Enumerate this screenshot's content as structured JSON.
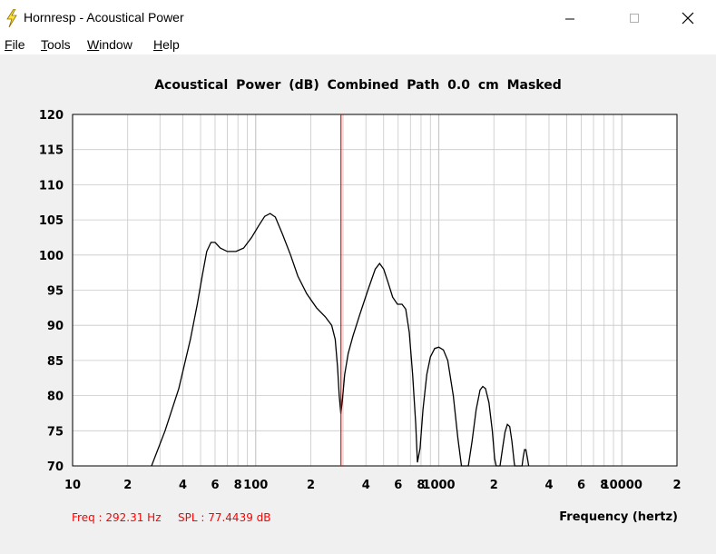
{
  "window": {
    "title": "Hornresp - Acoustical Power",
    "minimize_glyph": "—",
    "maximize_glyph": "☐",
    "close_glyph": "✕",
    "icon": "lightning-bolt-icon"
  },
  "menu": [
    "File",
    "Tools",
    "Window",
    "Help"
  ],
  "readout": {
    "freq": "Freq : 292.31 Hz",
    "spl": "SPL : 77.4439 dB"
  },
  "colors": {
    "cursor": "#ff0000",
    "curve": "#000000",
    "grid": "#c8c8c8",
    "readout": "#ff0000"
  },
  "chart_data": {
    "type": "line",
    "title": "Acoustical Power (dB)   Combined   Path 0.0 cm   Masked",
    "xlabel": "Frequency (hertz)",
    "ylabel": "",
    "x_scale": "log",
    "xlim": [
      10,
      20000
    ],
    "ylim": [
      70,
      120
    ],
    "y_ticks": [
      "120",
      "115",
      "110",
      "105",
      "100",
      "95",
      "90",
      "85",
      "80",
      "75",
      "70"
    ],
    "x_ticks": [
      {
        "value": 10,
        "label": "10"
      },
      {
        "value": 20,
        "label": "2"
      },
      {
        "value": 40,
        "label": "4"
      },
      {
        "value": 60,
        "label": "6"
      },
      {
        "value": 80,
        "label": "8"
      },
      {
        "value": 100,
        "label": "100"
      },
      {
        "value": 200,
        "label": "2"
      },
      {
        "value": 400,
        "label": "4"
      },
      {
        "value": 600,
        "label": "6"
      },
      {
        "value": 800,
        "label": "8"
      },
      {
        "value": 1000,
        "label": "1000"
      },
      {
        "value": 2000,
        "label": "2"
      },
      {
        "value": 4000,
        "label": "4"
      },
      {
        "value": 6000,
        "label": "6"
      },
      {
        "value": 8000,
        "label": "8"
      },
      {
        "value": 10000,
        "label": "10000"
      },
      {
        "value": 20000,
        "label": "2"
      }
    ],
    "grid": true,
    "cursor_x": 292.31,
    "series": [
      {
        "points": [
          [
            27,
            70
          ],
          [
            32,
            75
          ],
          [
            38,
            81
          ],
          [
            44,
            88
          ],
          [
            48,
            93
          ],
          [
            51,
            97
          ],
          [
            54,
            100.5
          ],
          [
            57,
            101.8
          ],
          [
            60,
            101.8
          ],
          [
            64,
            101
          ],
          [
            70,
            100.5
          ],
          [
            78,
            100.5
          ],
          [
            86,
            101
          ],
          [
            95,
            102.5
          ],
          [
            104,
            104.2
          ],
          [
            112,
            105.5
          ],
          [
            120,
            105.9
          ],
          [
            128,
            105.4
          ],
          [
            140,
            103
          ],
          [
            155,
            100
          ],
          [
            170,
            97
          ],
          [
            190,
            94.5
          ],
          [
            215,
            92.5
          ],
          [
            240,
            91.2
          ],
          [
            260,
            90
          ],
          [
            272,
            88
          ],
          [
            280,
            84
          ],
          [
            286,
            80
          ],
          [
            292,
            77.4
          ],
          [
            298,
            79.5
          ],
          [
            306,
            83
          ],
          [
            320,
            86
          ],
          [
            340,
            88.5
          ],
          [
            370,
            91.5
          ],
          [
            410,
            95
          ],
          [
            450,
            98
          ],
          [
            475,
            98.8
          ],
          [
            500,
            98
          ],
          [
            530,
            96
          ],
          [
            560,
            94
          ],
          [
            595,
            93
          ],
          [
            630,
            93
          ],
          [
            660,
            92.3
          ],
          [
            690,
            89
          ],
          [
            720,
            83
          ],
          [
            748,
            76
          ],
          [
            765,
            70.5
          ],
          [
            790,
            72.5
          ],
          [
            820,
            78
          ],
          [
            860,
            83
          ],
          [
            900,
            85.5
          ],
          [
            950,
            86.7
          ],
          [
            1000,
            86.9
          ],
          [
            1060,
            86.5
          ],
          [
            1120,
            85
          ],
          [
            1200,
            80
          ],
          [
            1270,
            74
          ],
          [
            1330,
            70
          ],
          [
            1450,
            70
          ],
          [
            1520,
            73.5
          ],
          [
            1600,
            78
          ],
          [
            1680,
            80.8
          ],
          [
            1740,
            81.3
          ],
          [
            1800,
            81
          ],
          [
            1880,
            79
          ],
          [
            1960,
            75
          ],
          [
            2020,
            71
          ],
          [
            2060,
            70
          ],
          [
            2160,
            70
          ],
          [
            2230,
            72.5
          ],
          [
            2300,
            74.8
          ],
          [
            2370,
            75.9
          ],
          [
            2440,
            75.6
          ],
          [
            2510,
            73.5
          ],
          [
            2580,
            70.5
          ],
          [
            2600,
            70
          ],
          [
            2850,
            70
          ],
          [
            2890,
            71.2
          ],
          [
            2940,
            72.3
          ],
          [
            2990,
            72.3
          ],
          [
            3050,
            71.1
          ],
          [
            3100,
            70
          ]
        ]
      }
    ]
  }
}
